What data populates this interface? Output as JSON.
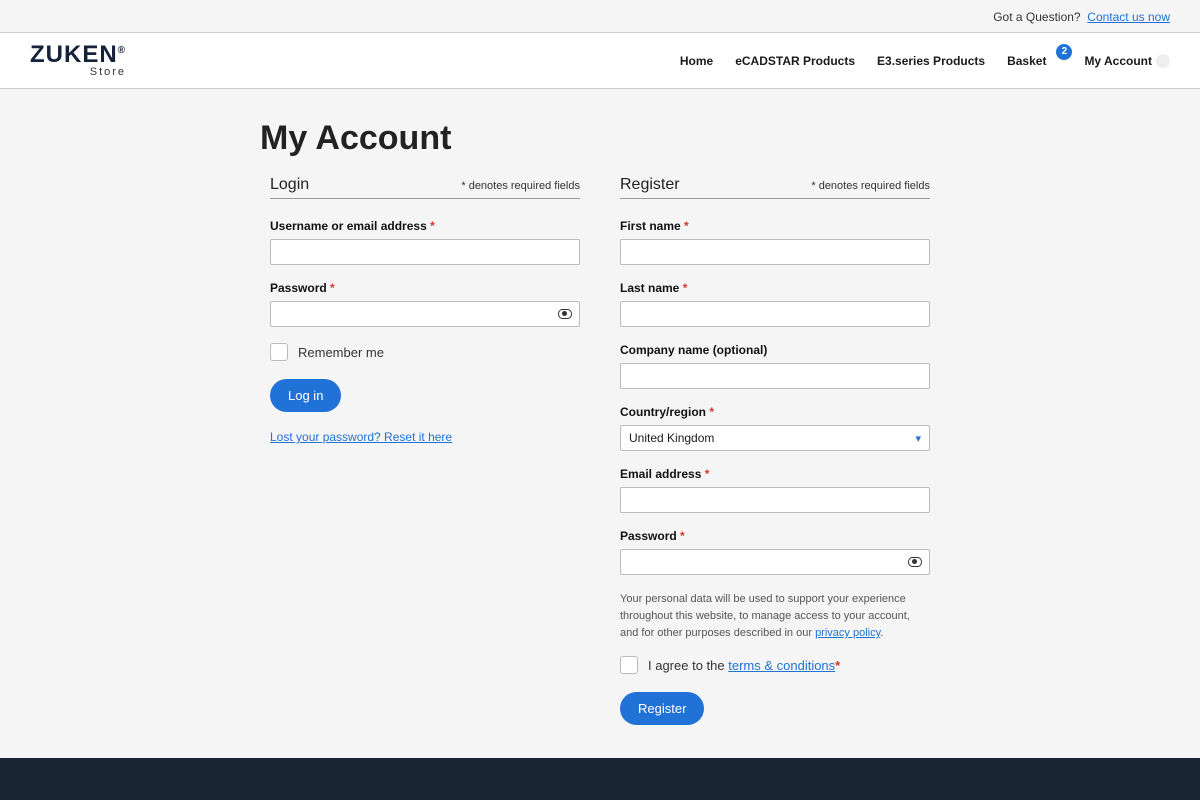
{
  "topbar": {
    "question": "Got a Question?",
    "contact_link": "Contact us now"
  },
  "header": {
    "logo_main": "ZUKEN",
    "logo_sub": "Store",
    "nav": {
      "home": "Home",
      "ecad": "eCADSTAR Products",
      "e3": "E3.series Products",
      "basket": "Basket",
      "basket_count": "2",
      "account": "My Account"
    }
  },
  "page": {
    "title": "My Account",
    "required_note": "* denotes required fields"
  },
  "login": {
    "heading": "Login",
    "username_label": "Username or email address",
    "password_label": "Password",
    "remember_label": "Remember me",
    "submit": "Log in",
    "lost_link": "Lost your password? Reset it here"
  },
  "register": {
    "heading": "Register",
    "firstname_label": "First name",
    "lastname_label": "Last name",
    "company_label": "Company name (optional)",
    "country_label": "Country/region",
    "country_value": "United Kingdom",
    "email_label": "Email address",
    "password_label": "Password",
    "privacy_text_1": "Your personal data will be used to support your experience throughout this website, to manage access to your account, and for other purposes described in our ",
    "privacy_link": "privacy policy",
    "privacy_text_2": ".",
    "agree_text_1": "I agree to the ",
    "agree_link": "terms & conditions",
    "submit": "Register"
  }
}
